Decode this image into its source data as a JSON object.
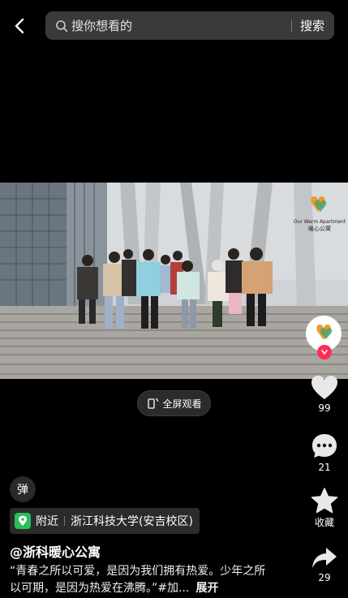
{
  "search": {
    "placeholder": "搜你想看的",
    "button": "搜索"
  },
  "video": {
    "watermark_en": "Our Warm Apartment",
    "watermark_cn": "暖心公寓"
  },
  "fullscreen_label": "全屏观看",
  "actions": {
    "likes": "99",
    "comments": "21",
    "favorite": "收藏",
    "shares": "29"
  },
  "danmu_label": "弹",
  "location": {
    "nearby": "附近",
    "place": "浙江科技大学(安吉校区)"
  },
  "author": "@浙科暖心公寓",
  "description": "“青春之所以可爱，是因为我们拥有热爱。少年之所以可期，是因为热爱在沸腾。”#加...",
  "expand_label": "展开",
  "colors": {
    "accent": "#fe2c55",
    "location_icon": "#2bbf5a",
    "background": "#000000"
  }
}
